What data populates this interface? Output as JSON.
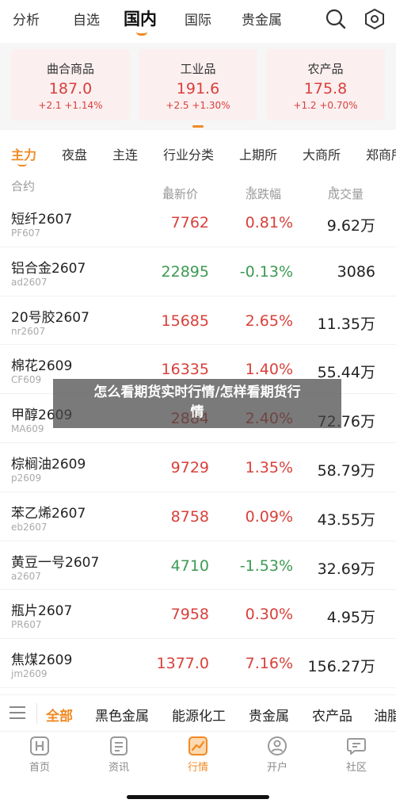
{
  "topnav": {
    "tabs": [
      {
        "label": "分析"
      },
      {
        "label": "自选"
      },
      {
        "label": "国内"
      },
      {
        "label": "国际"
      },
      {
        "label": "贵金属"
      }
    ],
    "icons": [
      "search-icon",
      "settings-hexagon-icon"
    ]
  },
  "index_cards": [
    {
      "name": "曲合商品",
      "price": "187.0",
      "change": "+2.1 +1.14%"
    },
    {
      "name": "工业品",
      "price": "191.6",
      "change": "+2.5 +1.30%"
    },
    {
      "name": "农产品",
      "price": "175.8",
      "change": "+1.2 +0.70%"
    }
  ],
  "subtabs": [
    {
      "label": "主力"
    },
    {
      "label": "夜盘"
    },
    {
      "label": "主连"
    },
    {
      "label": "行业分类"
    },
    {
      "label": "上期所"
    },
    {
      "label": "大商所"
    },
    {
      "label": "郑商所"
    }
  ],
  "table": {
    "headers": {
      "contract": "合约",
      "price": "最新价",
      "change": "涨跌幅",
      "volume": "成交量"
    },
    "rows": [
      {
        "name": "短纤2607",
        "code": "PF607",
        "price": "7762",
        "change": "0.81%",
        "volume": "9.62万",
        "dir": "up"
      },
      {
        "name": "铝合金2607",
        "code": "ad2607",
        "price": "22895",
        "change": "-0.13%",
        "volume": "3086",
        "dir": "down"
      },
      {
        "name": "20号胶2607",
        "code": "nr2607",
        "price": "15685",
        "change": "2.65%",
        "volume": "11.35万",
        "dir": "up"
      },
      {
        "name": "棉花2609",
        "code": "CF609",
        "price": "16335",
        "change": "1.40%",
        "volume": "55.44万",
        "dir": "up"
      },
      {
        "name": "甲醇2609",
        "code": "MA609",
        "price": "2884",
        "change": "2.40%",
        "volume": "72.76万",
        "dir": "up"
      },
      {
        "name": "棕榈油2609",
        "code": "p2609",
        "price": "9729",
        "change": "1.35%",
        "volume": "58.79万",
        "dir": "up"
      },
      {
        "name": "苯乙烯2607",
        "code": "eb2607",
        "price": "8758",
        "change": "0.09%",
        "volume": "43.55万",
        "dir": "up"
      },
      {
        "name": "黄豆一号2607",
        "code": "a2607",
        "price": "4710",
        "change": "-1.53%",
        "volume": "32.69万",
        "dir": "down"
      },
      {
        "name": "瓶片2607",
        "code": "PR607",
        "price": "7958",
        "change": "0.30%",
        "volume": "4.95万",
        "dir": "up"
      },
      {
        "name": "焦煤2609",
        "code": "jm2609",
        "price": "1377.0",
        "change": "7.16%",
        "volume": "156.27万",
        "dir": "up"
      }
    ]
  },
  "banner": {
    "line1": "怎么看期货实时行情/怎样看期货行",
    "line2": "情"
  },
  "categories": [
    {
      "label": "全部"
    },
    {
      "label": "黑色金属"
    },
    {
      "label": "能源化工"
    },
    {
      "label": "贵金属"
    },
    {
      "label": "农产品"
    },
    {
      "label": "油脂"
    }
  ],
  "bottomnav": [
    {
      "label": "首页",
      "icon": "home-h-icon"
    },
    {
      "label": "资讯",
      "icon": "news-icon"
    },
    {
      "label": "行情",
      "icon": "market-chart-icon"
    },
    {
      "label": "开户",
      "icon": "account-open-icon"
    },
    {
      "label": "社区",
      "icon": "community-chat-icon"
    }
  ],
  "colors": {
    "accent": "#f08a24",
    "up": "#d9403a",
    "down": "#3c9a52",
    "card_bg": "#fbeff0"
  }
}
